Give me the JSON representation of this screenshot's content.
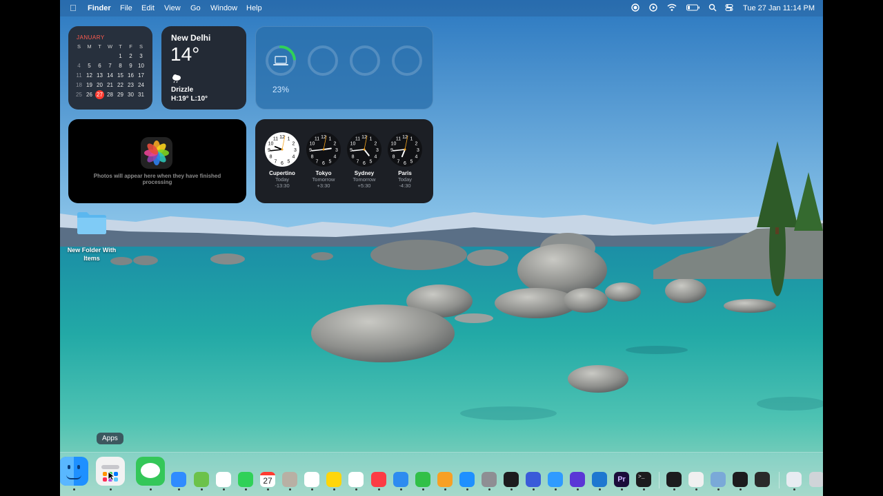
{
  "menubar": {
    "app_name": "Finder",
    "menus": [
      "File",
      "Edit",
      "View",
      "Go",
      "Window",
      "Help"
    ],
    "clock": "Tue 27 Jan  11:14 PM",
    "status_icons": [
      "record-icon",
      "play-icon",
      "wifi-icon",
      "battery-icon",
      "search-icon",
      "control-center-icon"
    ]
  },
  "calendar": {
    "month": "JANUARY",
    "weekdays": [
      "S",
      "M",
      "T",
      "W",
      "T",
      "F",
      "S"
    ],
    "weeks": [
      [
        "",
        "",
        "",
        "",
        "1",
        "2",
        "3"
      ],
      [
        "4",
        "5",
        "6",
        "7",
        "8",
        "9",
        "10"
      ],
      [
        "11",
        "12",
        "13",
        "14",
        "15",
        "16",
        "17"
      ],
      [
        "18",
        "19",
        "20",
        "21",
        "22",
        "23",
        "24"
      ],
      [
        "25",
        "26",
        "27",
        "28",
        "29",
        "30",
        "31"
      ]
    ],
    "today": "27"
  },
  "weather": {
    "city": "New Delhi",
    "temp": "14°",
    "condition": "Drizzle",
    "hi_lo": "H:19° L:10°",
    "icon": "drizzle-icon"
  },
  "batteries": {
    "percent_label": "23%",
    "level": 0.23,
    "color": "#30d158"
  },
  "photos": {
    "message": "Photos will appear here when they have finished processing"
  },
  "world_clocks": [
    {
      "city": "Cupertino",
      "day": "Today",
      "offset": "-13:30",
      "hour": 9,
      "minute": 44,
      "light": true
    },
    {
      "city": "Tokyo",
      "day": "Tomorrow",
      "offset": "+3:30",
      "hour": 2,
      "minute": 44,
      "light": false
    },
    {
      "city": "Sydney",
      "day": "Tomorrow",
      "offset": "+5:30",
      "hour": 4,
      "minute": 44,
      "light": false
    },
    {
      "city": "Paris",
      "day": "Today",
      "offset": "-4:30",
      "hour": 6,
      "minute": 44,
      "light": false
    }
  ],
  "desktop": {
    "folder_label": "New Folder With Items"
  },
  "tooltip": "Apps",
  "dock": {
    "apps": [
      {
        "name": "finder-icon",
        "color": "#1e90ff"
      },
      {
        "name": "apps-icon",
        "color": "#f2f2f2"
      },
      {
        "name": "messages-icon",
        "color": "#34c759"
      },
      {
        "name": "mail-icon",
        "color": "#2f8cff"
      },
      {
        "name": "maps-icon",
        "color": "#6cc24a"
      },
      {
        "name": "photos-icon",
        "color": "#ffffff"
      },
      {
        "name": "facetime-icon",
        "color": "#30d158"
      },
      {
        "name": "calendar-icon",
        "color": "#ffffff"
      },
      {
        "name": "contacts-icon",
        "color": "#b8b0a4"
      },
      {
        "name": "reminders-icon",
        "color": "#ffffff"
      },
      {
        "name": "notes-icon",
        "color": "#ffd60a"
      },
      {
        "name": "freeform-icon",
        "color": "#ffffff"
      },
      {
        "name": "music-icon",
        "color": "#fc3c44"
      },
      {
        "name": "keynote-icon",
        "color": "#2d8cf0"
      },
      {
        "name": "numbers-icon",
        "color": "#31c048"
      },
      {
        "name": "pages-icon",
        "color": "#f7a024"
      },
      {
        "name": "app-store-icon",
        "color": "#1e90ff"
      },
      {
        "name": "system-settings-icon",
        "color": "#8e8e93"
      },
      {
        "name": "safari-tech-icon",
        "color": "#1c1c1e"
      },
      {
        "name": "mirroring-icon",
        "color": "#3a5bd9"
      },
      {
        "name": "safari-icon",
        "color": "#2f9bff"
      },
      {
        "name": "spotlight-icon",
        "color": "#5a36d6"
      },
      {
        "name": "vscode-icon",
        "color": "#1e78d0"
      },
      {
        "name": "premiere-icon",
        "color": "#1a0d3a"
      },
      {
        "name": "terminal-icon",
        "color": "#1c1c1e"
      },
      {
        "name": "activity-monitor-icon",
        "color": "#1c1c1e"
      },
      {
        "name": "preview-icon",
        "color": "#f0f0f0"
      },
      {
        "name": "finder-helper-icon",
        "color": "#7aa9d8"
      },
      {
        "name": "piano-icon",
        "color": "#1c1c1e"
      },
      {
        "name": "siri-icon",
        "color": "#2a2a2a"
      },
      {
        "name": "downloads-icon",
        "color": "#e8ecf2"
      },
      {
        "name": "trash-icon",
        "color": "#d0d4d8"
      }
    ],
    "calendar_day": "27",
    "premiere_label": "Pr",
    "terminal_label": ">_"
  }
}
